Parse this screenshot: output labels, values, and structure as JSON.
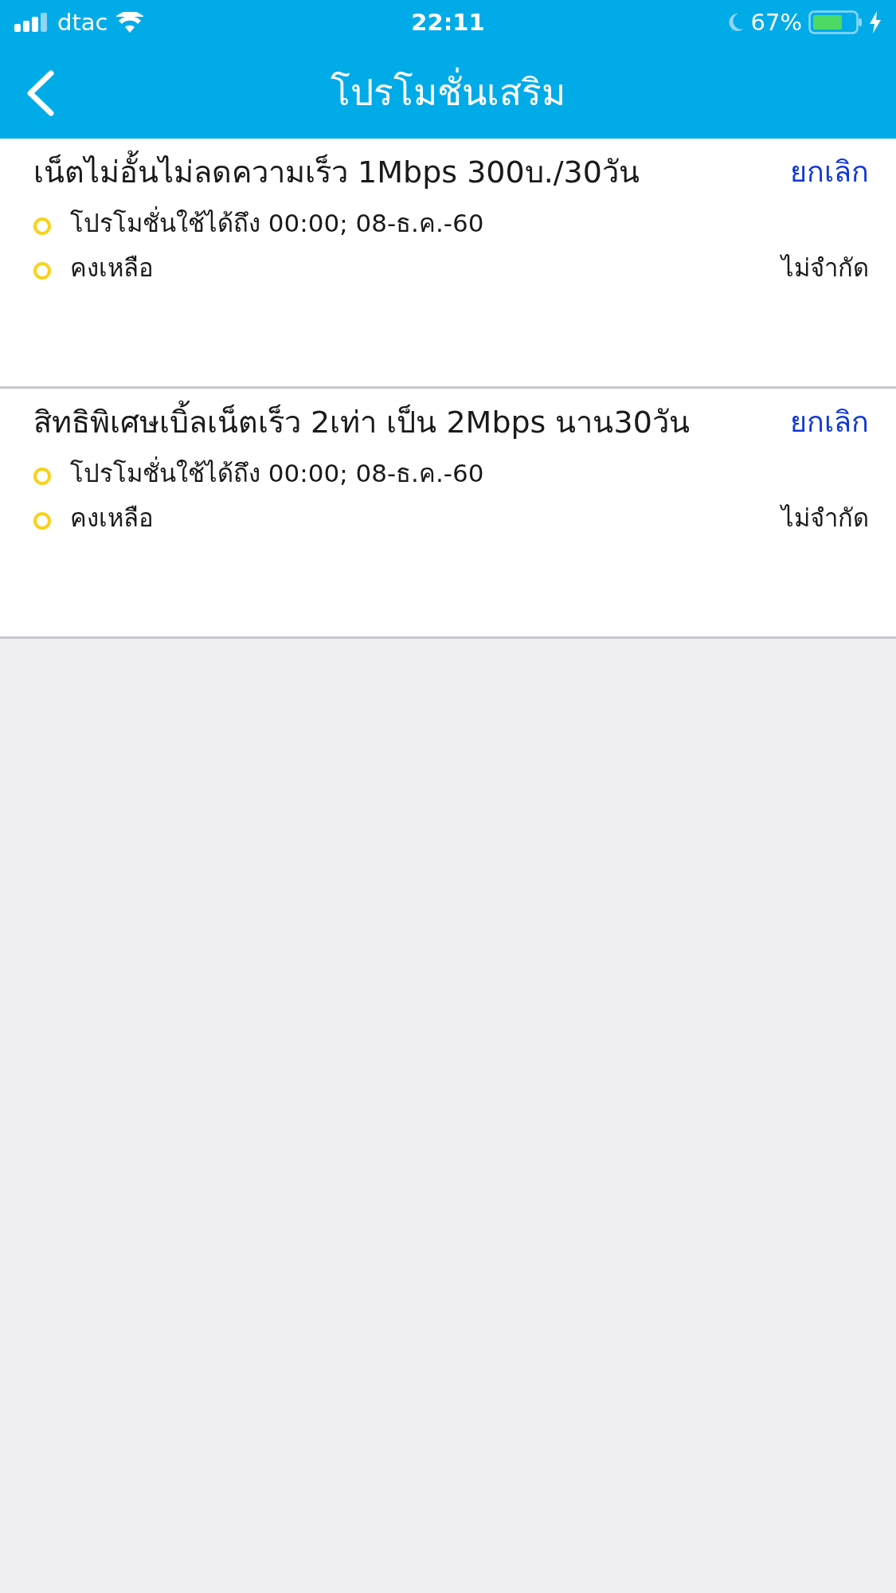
{
  "status_bar": {
    "carrier": "dtac",
    "time": "22:11",
    "battery_percent": "67%"
  },
  "nav_bar": {
    "title": "โปรโมชั่นเสริม"
  },
  "promotions": [
    {
      "name": "เน็ตไม่อั้นไม่ลดความเร็ว 1Mbps 300บ./30วัน",
      "action": "ยกเลิก",
      "details": [
        {
          "label": "โปรโมชั่นใช้ได้ถึง 00:00; 08-ธ.ค.-60"
        },
        {
          "label": "คงเหลือ",
          "value": "ไม่จำกัด"
        }
      ]
    },
    {
      "name": "สิทธิพิเศษเบิ้ลเน็ตเร็ว 2เท่า เป็น 2Mbps นาน30วัน",
      "action": "ยกเลิก",
      "details": [
        {
          "label": "โปรโมชั่นใช้ได้ถึง 00:00; 08-ธ.ค.-60"
        },
        {
          "label": "คงเหลือ",
          "value": "ไม่จำกัด"
        }
      ]
    }
  ]
}
